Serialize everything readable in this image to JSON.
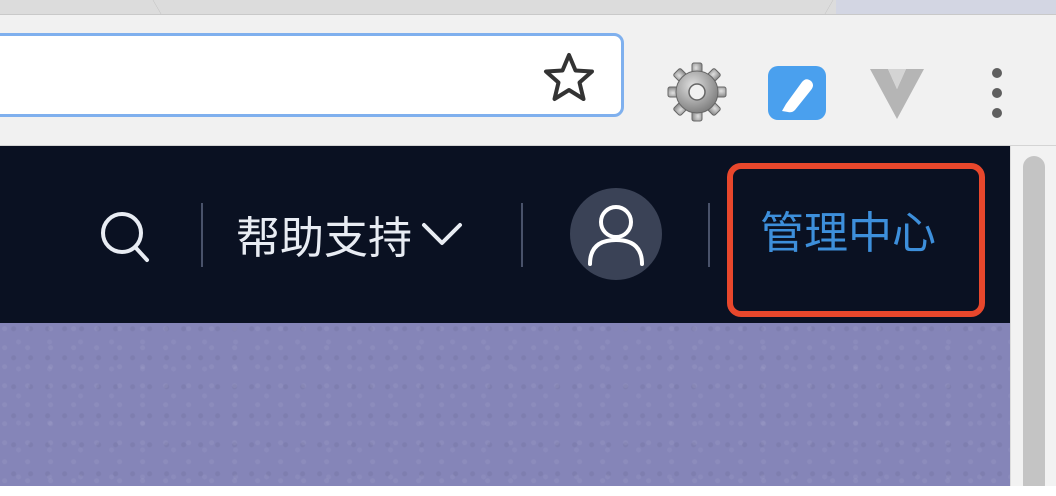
{
  "browser": {
    "address_bar": {
      "value": "",
      "placeholder": ""
    },
    "icons": {
      "bookmark": "star-icon",
      "extension_1": "gear-icon",
      "extension_2": "blue-tag-extension-icon",
      "extension_3": "v-extension-icon",
      "menu": "more-vertical-icon"
    }
  },
  "site_nav": {
    "help_label": "帮助支持",
    "admin_label": "管理中心",
    "colors": {
      "header_bg": "#0a1122",
      "admin_link": "#3d8fdb",
      "highlight": "#e8472c",
      "hero_bg": "#8585b8"
    },
    "icons": {
      "search": "search-icon",
      "help_dropdown": "chevron-down-icon",
      "avatar": "user-avatar-icon"
    }
  }
}
